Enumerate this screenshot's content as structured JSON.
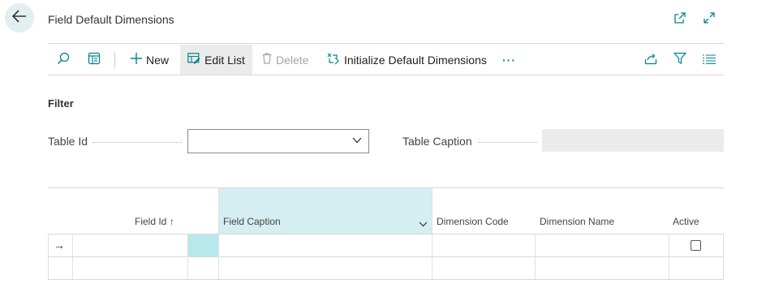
{
  "page": {
    "title": "Field Default Dimensions"
  },
  "toolbar": {
    "new_label": "New",
    "edit_list_label": "Edit List",
    "delete_label": "Delete",
    "init_label": "Initialize Default Dimensions",
    "more_label": "···"
  },
  "filter": {
    "title": "Filter",
    "table_id_label": "Table Id",
    "table_id_value": "",
    "table_caption_label": "Table Caption",
    "table_caption_value": ""
  },
  "grid": {
    "columns": {
      "field_id": "Field Id",
      "field_id_sort": "↑",
      "field_caption": "Field Caption",
      "dimension_code": "Dimension Code",
      "dimension_name": "Dimension Name",
      "active": "Active"
    },
    "row_indicator": "→",
    "rows": [
      {
        "field_id": "",
        "field_caption": "",
        "dimension_code": "",
        "dimension_name": "",
        "active": false
      },
      {
        "field_id": "",
        "field_caption": "",
        "dimension_code": "",
        "dimension_name": ""
      }
    ]
  },
  "colors": {
    "accent": "#00838f",
    "header_highlight": "#d4eef1",
    "cell_highlight": "#b6e8ec",
    "back_bg": "#e1eff0"
  }
}
